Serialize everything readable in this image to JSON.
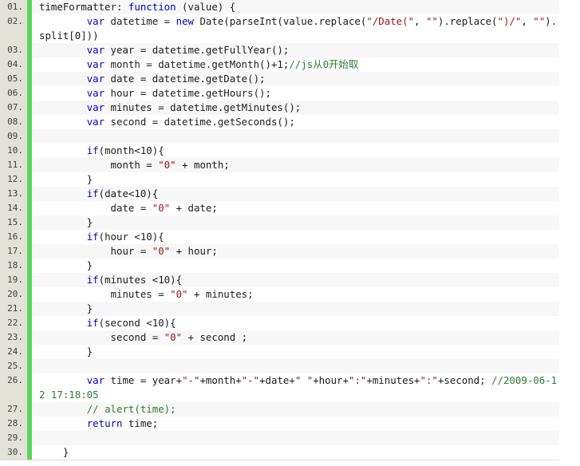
{
  "editor": {
    "language": "javascript",
    "gutter_background": "#e4e1d8",
    "marker_color": "#5cd65c",
    "alt_row_background": "#f7f7f7",
    "keyword_color": "#0000c8",
    "string_color": "#a31515",
    "comment_color": "#2e7d32",
    "text_color": "#1c1c1c"
  },
  "lines": [
    {
      "number": "01.",
      "tokens": [
        {
          "t": "pln",
          "v": "timeFormatter: "
        },
        {
          "t": "kw",
          "v": "function"
        },
        {
          "t": "pln",
          "v": " (value) {"
        }
      ]
    },
    {
      "number": "02.",
      "tokens": [
        {
          "t": "pln",
          "v": "        "
        },
        {
          "t": "kw",
          "v": "var"
        },
        {
          "t": "pln",
          "v": " datetime = "
        },
        {
          "t": "kw",
          "v": "new"
        },
        {
          "t": "pln",
          "v": " Date(parseInt(value.replace("
        },
        {
          "t": "str",
          "v": "\"/Date(\""
        },
        {
          "t": "pln",
          "v": ", "
        },
        {
          "t": "str",
          "v": "\"\""
        },
        {
          "t": "pln",
          "v": ").replace("
        },
        {
          "t": "str",
          "v": "\")/\""
        },
        {
          "t": "pln",
          "v": ", "
        },
        {
          "t": "str",
          "v": "\"\""
        },
        {
          "t": "pln",
          "v": ").split[0]))"
        }
      ]
    },
    {
      "number": "03.",
      "tokens": [
        {
          "t": "pln",
          "v": "        "
        },
        {
          "t": "kw",
          "v": "var"
        },
        {
          "t": "pln",
          "v": " year = datetime.getFullYear();"
        }
      ]
    },
    {
      "number": "04.",
      "tokens": [
        {
          "t": "pln",
          "v": "        "
        },
        {
          "t": "kw",
          "v": "var"
        },
        {
          "t": "pln",
          "v": " month = datetime.getMonth()+1;"
        },
        {
          "t": "cmt",
          "v": "//js从0开始取"
        }
      ]
    },
    {
      "number": "05.",
      "tokens": [
        {
          "t": "pln",
          "v": "        "
        },
        {
          "t": "kw",
          "v": "var"
        },
        {
          "t": "pln",
          "v": " date = datetime.getDate();"
        }
      ]
    },
    {
      "number": "06.",
      "tokens": [
        {
          "t": "pln",
          "v": "        "
        },
        {
          "t": "kw",
          "v": "var"
        },
        {
          "t": "pln",
          "v": " hour = datetime.getHours();"
        }
      ]
    },
    {
      "number": "07.",
      "tokens": [
        {
          "t": "pln",
          "v": "        "
        },
        {
          "t": "kw",
          "v": "var"
        },
        {
          "t": "pln",
          "v": " minutes = datetime.getMinutes();"
        }
      ]
    },
    {
      "number": "08.",
      "tokens": [
        {
          "t": "pln",
          "v": "        "
        },
        {
          "t": "kw",
          "v": "var"
        },
        {
          "t": "pln",
          "v": " second = datetime.getSeconds();"
        }
      ]
    },
    {
      "number": "09.",
      "tokens": [
        {
          "t": "pln",
          "v": ""
        }
      ]
    },
    {
      "number": "10.",
      "tokens": [
        {
          "t": "pln",
          "v": "        "
        },
        {
          "t": "kw",
          "v": "if"
        },
        {
          "t": "pln",
          "v": "(month<10){"
        }
      ]
    },
    {
      "number": "11.",
      "tokens": [
        {
          "t": "pln",
          "v": "            month = "
        },
        {
          "t": "str",
          "v": "\"0\""
        },
        {
          "t": "pln",
          "v": " + month;"
        }
      ]
    },
    {
      "number": "12.",
      "tokens": [
        {
          "t": "pln",
          "v": "        }"
        }
      ]
    },
    {
      "number": "13.",
      "tokens": [
        {
          "t": "pln",
          "v": "        "
        },
        {
          "t": "kw",
          "v": "if"
        },
        {
          "t": "pln",
          "v": "(date<10){"
        }
      ]
    },
    {
      "number": "14.",
      "tokens": [
        {
          "t": "pln",
          "v": "            date = "
        },
        {
          "t": "str",
          "v": "\"0\""
        },
        {
          "t": "pln",
          "v": " + date;"
        }
      ]
    },
    {
      "number": "15.",
      "tokens": [
        {
          "t": "pln",
          "v": "        }"
        }
      ]
    },
    {
      "number": "16.",
      "tokens": [
        {
          "t": "pln",
          "v": "        "
        },
        {
          "t": "kw",
          "v": "if"
        },
        {
          "t": "pln",
          "v": "(hour <10){"
        }
      ]
    },
    {
      "number": "17.",
      "tokens": [
        {
          "t": "pln",
          "v": "            hour = "
        },
        {
          "t": "str",
          "v": "\"0\""
        },
        {
          "t": "pln",
          "v": " + hour;"
        }
      ]
    },
    {
      "number": "18.",
      "tokens": [
        {
          "t": "pln",
          "v": "        }"
        }
      ]
    },
    {
      "number": "19.",
      "tokens": [
        {
          "t": "pln",
          "v": "        "
        },
        {
          "t": "kw",
          "v": "if"
        },
        {
          "t": "pln",
          "v": "(minutes <10){"
        }
      ]
    },
    {
      "number": "20.",
      "tokens": [
        {
          "t": "pln",
          "v": "            minutes = "
        },
        {
          "t": "str",
          "v": "\"0\""
        },
        {
          "t": "pln",
          "v": " + minutes;"
        }
      ]
    },
    {
      "number": "21.",
      "tokens": [
        {
          "t": "pln",
          "v": "        }"
        }
      ]
    },
    {
      "number": "22.",
      "tokens": [
        {
          "t": "pln",
          "v": "        "
        },
        {
          "t": "kw",
          "v": "if"
        },
        {
          "t": "pln",
          "v": "(second <10){"
        }
      ]
    },
    {
      "number": "23.",
      "tokens": [
        {
          "t": "pln",
          "v": "            second = "
        },
        {
          "t": "str",
          "v": "\"0\""
        },
        {
          "t": "pln",
          "v": " + second ;"
        }
      ]
    },
    {
      "number": "24.",
      "tokens": [
        {
          "t": "pln",
          "v": "        }"
        }
      ]
    },
    {
      "number": "25.",
      "tokens": [
        {
          "t": "pln",
          "v": ""
        }
      ]
    },
    {
      "number": "26.",
      "tokens": [
        {
          "t": "pln",
          "v": "        "
        },
        {
          "t": "kw",
          "v": "var"
        },
        {
          "t": "pln",
          "v": " time = year+"
        },
        {
          "t": "str",
          "v": "\"-\""
        },
        {
          "t": "pln",
          "v": "+month+"
        },
        {
          "t": "str",
          "v": "\"-\""
        },
        {
          "t": "pln",
          "v": "+date+"
        },
        {
          "t": "str",
          "v": "\" \""
        },
        {
          "t": "pln",
          "v": "+hour+"
        },
        {
          "t": "str",
          "v": "\":\""
        },
        {
          "t": "pln",
          "v": "+minutes+"
        },
        {
          "t": "str",
          "v": "\":\""
        },
        {
          "t": "pln",
          "v": "+second; "
        },
        {
          "t": "cmt",
          "v": "//2009-06-12 17:18:05"
        }
      ]
    },
    {
      "number": "27.",
      "tokens": [
        {
          "t": "pln",
          "v": "        "
        },
        {
          "t": "cmt",
          "v": "// alert(time);"
        }
      ]
    },
    {
      "number": "28.",
      "tokens": [
        {
          "t": "pln",
          "v": "        "
        },
        {
          "t": "kw",
          "v": "return"
        },
        {
          "t": "pln",
          "v": " time;"
        }
      ]
    },
    {
      "number": "29.",
      "tokens": [
        {
          "t": "pln",
          "v": ""
        }
      ]
    },
    {
      "number": "30.",
      "tokens": [
        {
          "t": "pln",
          "v": "    }"
        }
      ]
    }
  ]
}
